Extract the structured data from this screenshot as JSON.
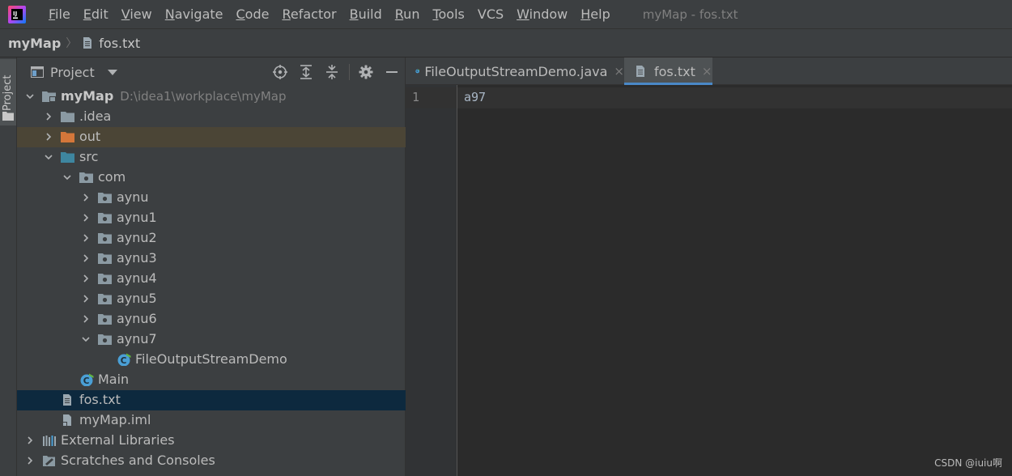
{
  "menubar": {
    "items": [
      {
        "mnemonic": "F",
        "rest": "ile"
      },
      {
        "mnemonic": "E",
        "rest": "dit"
      },
      {
        "mnemonic": "V",
        "rest": "iew"
      },
      {
        "mnemonic": "N",
        "rest": "avigate"
      },
      {
        "mnemonic": "C",
        "rest": "ode"
      },
      {
        "mnemonic": "R",
        "rest": "efactor"
      },
      {
        "mnemonic": "B",
        "rest": "uild"
      },
      {
        "mnemonic": "R",
        "rest": "un"
      },
      {
        "mnemonic": "T",
        "rest": "ools"
      },
      {
        "mnemonic": "",
        "rest": "VCS"
      },
      {
        "mnemonic": "W",
        "rest": "indow"
      },
      {
        "mnemonic": "H",
        "rest": "elp"
      }
    ],
    "window_title": "myMap - fos.txt"
  },
  "navbar": {
    "project": "myMap",
    "file": "fos.txt"
  },
  "left_stripe": {
    "project_label": "Project"
  },
  "project_panel": {
    "title": "Project",
    "tree": [
      {
        "label": "myMap",
        "path": "D:\\idea1\\workplace\\myMap",
        "icon": "module-folder-icon",
        "expanded": true
      },
      {
        "label": ".idea",
        "icon": "folder-icon",
        "expanded": false
      },
      {
        "label": "out",
        "icon": "excluded-folder-icon",
        "expanded": false
      },
      {
        "label": "src",
        "icon": "source-folder-icon",
        "expanded": true
      },
      {
        "label": "com",
        "icon": "package-icon",
        "expanded": true
      },
      {
        "label": "aynu",
        "icon": "package-icon",
        "expanded": false
      },
      {
        "label": "aynu1",
        "icon": "package-icon",
        "expanded": false
      },
      {
        "label": "aynu2",
        "icon": "package-icon",
        "expanded": false
      },
      {
        "label": "aynu3",
        "icon": "package-icon",
        "expanded": false
      },
      {
        "label": "aynu4",
        "icon": "package-icon",
        "expanded": false
      },
      {
        "label": "aynu5",
        "icon": "package-icon",
        "expanded": false
      },
      {
        "label": "aynu6",
        "icon": "package-icon",
        "expanded": false
      },
      {
        "label": "aynu7",
        "icon": "package-icon",
        "expanded": true
      },
      {
        "label": "FileOutputStreamDemo",
        "icon": "java-class-icon"
      },
      {
        "label": "Main",
        "icon": "java-class-icon"
      },
      {
        "label": "fos.txt",
        "icon": "text-file-icon",
        "selected": true
      },
      {
        "label": "myMap.iml",
        "icon": "iml-file-icon"
      },
      {
        "label": "External Libraries",
        "icon": "libraries-icon",
        "expanded": false
      },
      {
        "label": "Scratches and Consoles",
        "icon": "scratches-icon",
        "expanded": false
      }
    ]
  },
  "editor": {
    "tabs": [
      {
        "label": "FileOutputStreamDemo.java",
        "icon": "java-class-icon",
        "active": false
      },
      {
        "label": "fos.txt",
        "icon": "text-file-icon",
        "active": true
      }
    ],
    "close_glyph": "×",
    "line_number": "1",
    "content": "a97"
  },
  "watermark": "CSDN @iuiu啊",
  "colors": {
    "background": "#2b2b2b",
    "panel": "#3c3f41",
    "selection": "#0d293e",
    "excluded_row": "#4b4536",
    "accent": "#4a88c7"
  }
}
